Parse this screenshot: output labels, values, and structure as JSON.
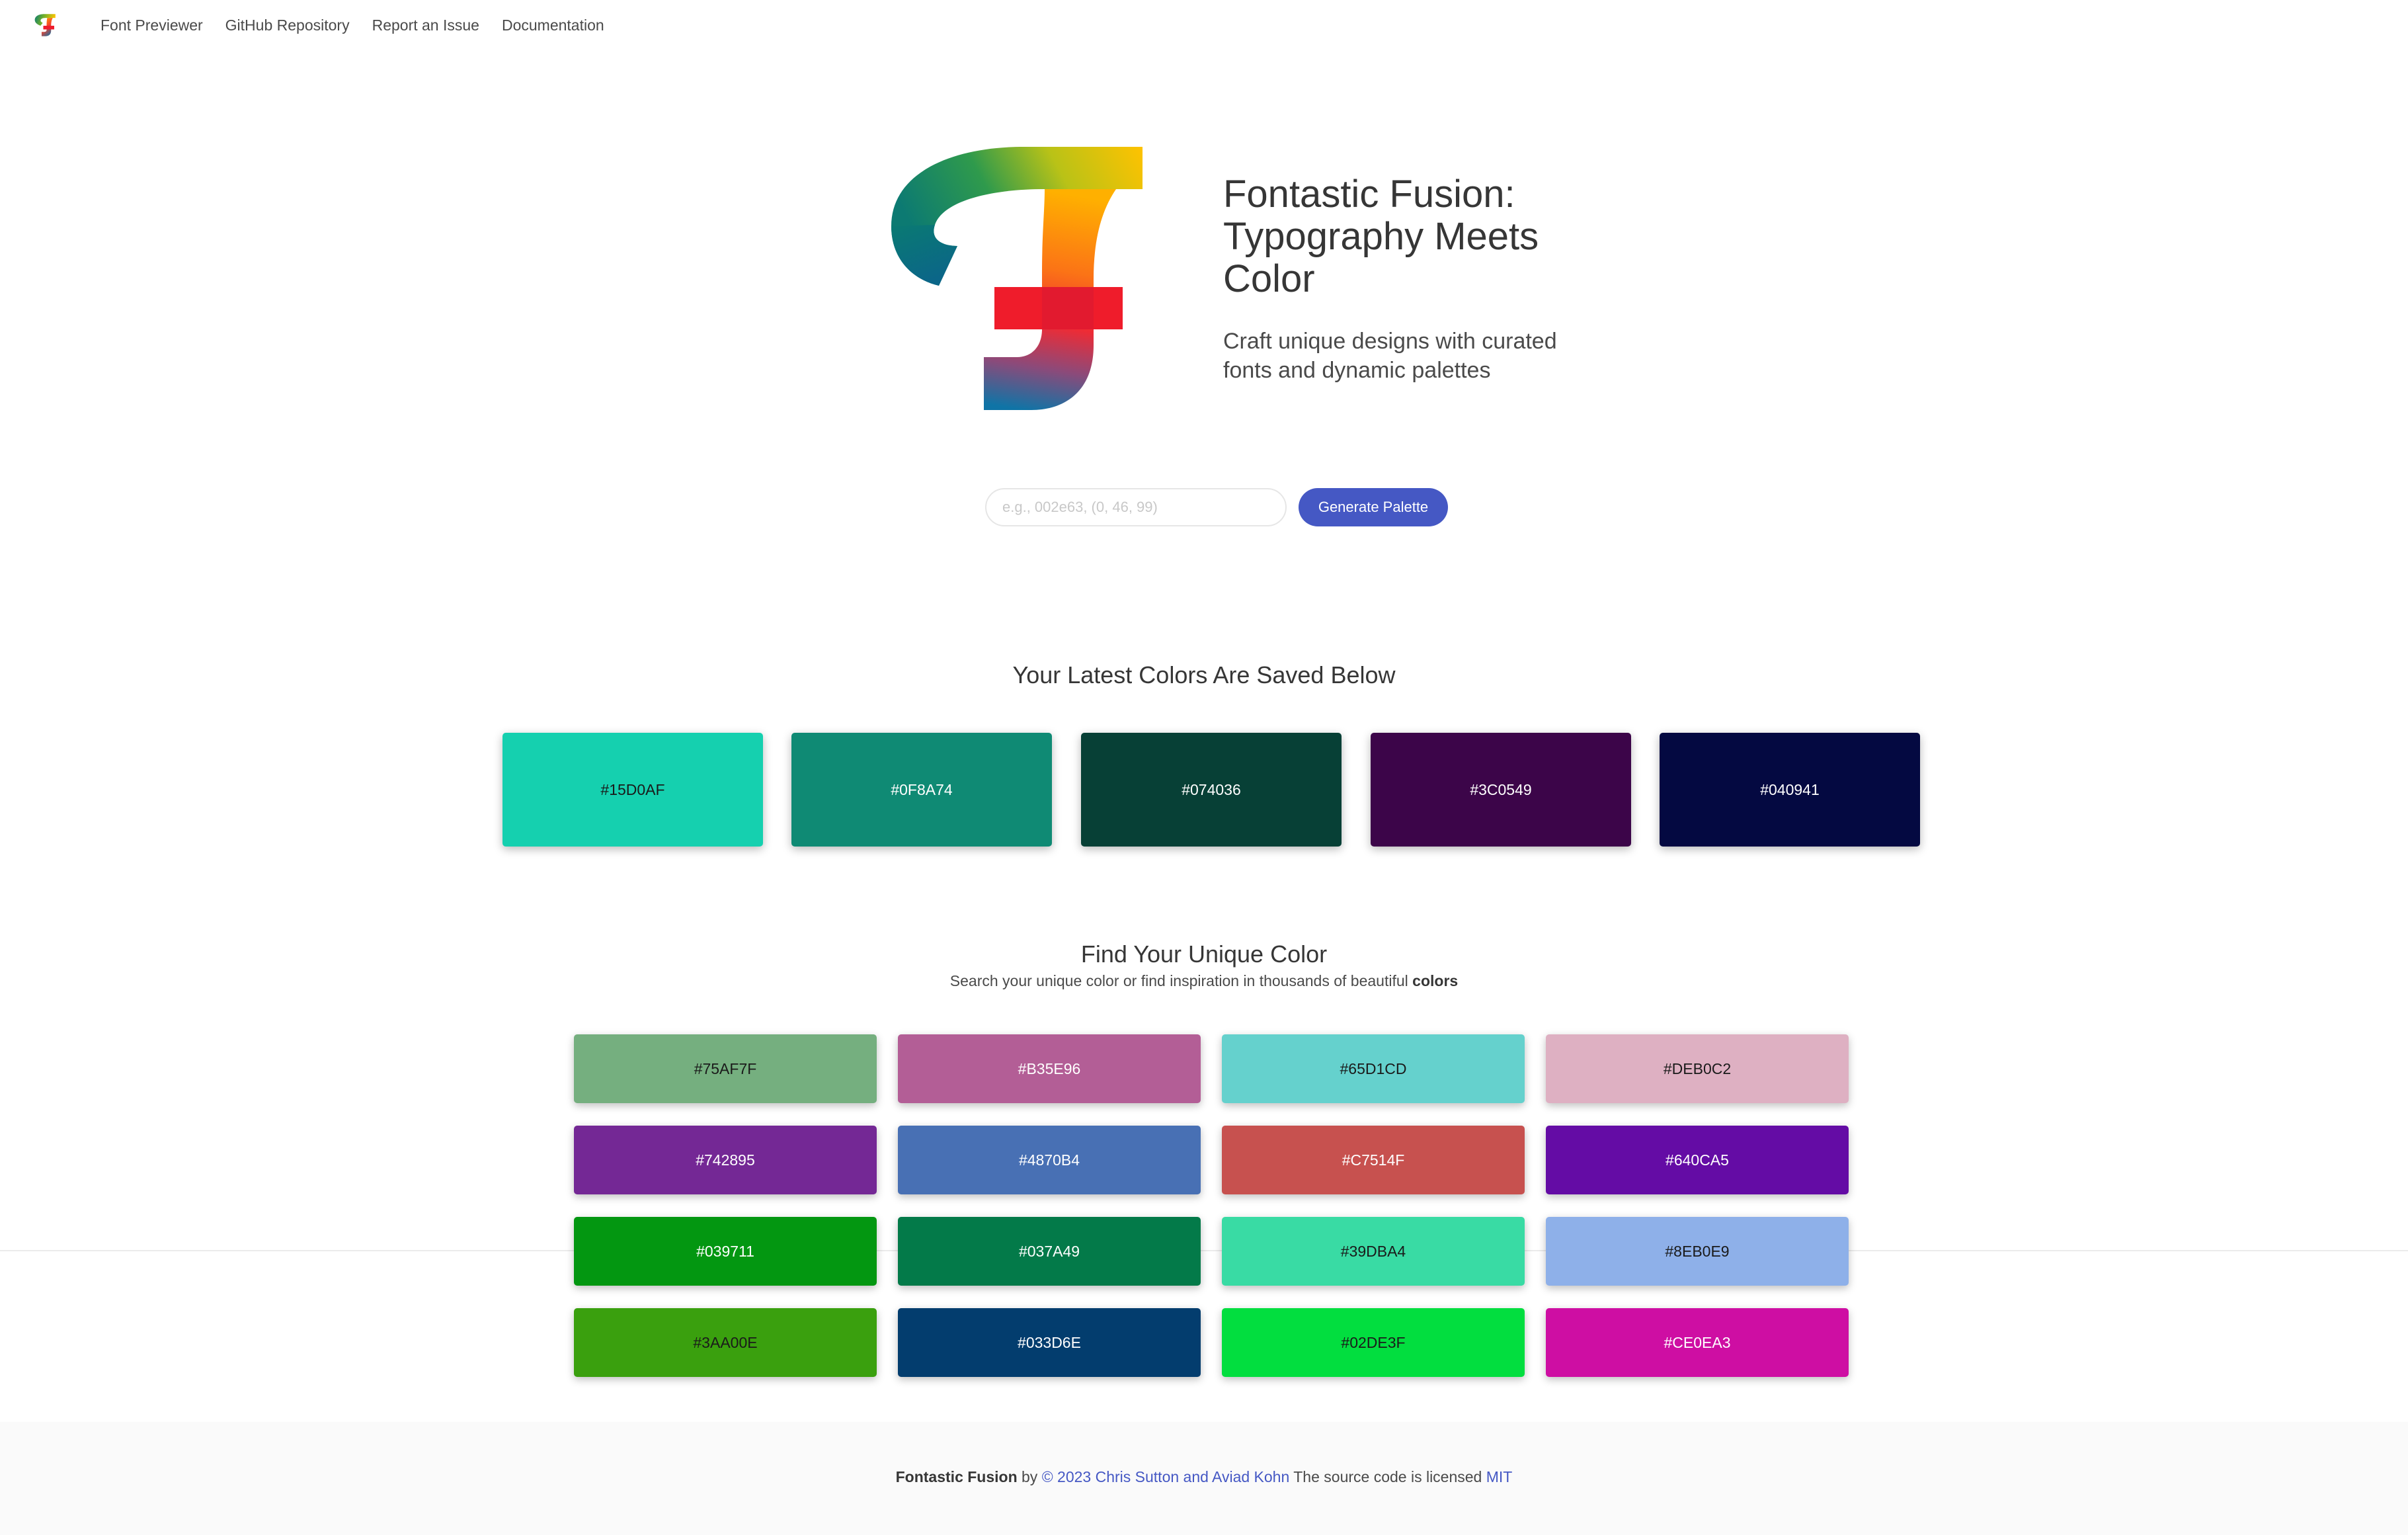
{
  "nav": {
    "logo_icon": "fontastic-fusion-logo-icon",
    "links": [
      "Font Previewer",
      "GitHub Repository",
      "Report an Issue",
      "Documentation"
    ]
  },
  "hero": {
    "title": "Fontastic Fusion: Typography Meets Color",
    "subtitle": "Craft unique designs with curated fonts and dynamic palettes"
  },
  "search": {
    "placeholder": "e.g., 002e63, (0, 46, 99)",
    "value": "",
    "button_label": "Generate Palette"
  },
  "latest": {
    "title": "Your Latest Colors Are Saved Below",
    "colors": [
      {
        "hex": "#15D0AF",
        "text_color": "#1a1a1a"
      },
      {
        "hex": "#0F8A74",
        "text_color": "#ffffff"
      },
      {
        "hex": "#074036",
        "text_color": "#ffffff"
      },
      {
        "hex": "#3C0549",
        "text_color": "#ffffff"
      },
      {
        "hex": "#040941",
        "text_color": "#ffffff"
      }
    ]
  },
  "find": {
    "title": "Find Your Unique Color",
    "subtitle": "Search your unique color or find inspiration in thousands of beautiful",
    "subtitle_bold": "colors",
    "colors": [
      {
        "hex": "#75AF7F",
        "text_color": "#1a1a1a"
      },
      {
        "hex": "#B35E96",
        "text_color": "#ffffff"
      },
      {
        "hex": "#65D1CD",
        "text_color": "#1a1a1a"
      },
      {
        "hex": "#DEB0C2",
        "text_color": "#1a1a1a"
      },
      {
        "hex": "#742895",
        "text_color": "#ffffff"
      },
      {
        "hex": "#4870B4",
        "text_color": "#ffffff"
      },
      {
        "hex": "#C7514F",
        "text_color": "#ffffff"
      },
      {
        "hex": "#640CA5",
        "text_color": "#ffffff"
      },
      {
        "hex": "#039711",
        "text_color": "#ffffff"
      },
      {
        "hex": "#037A49",
        "text_color": "#ffffff"
      },
      {
        "hex": "#39DBA4",
        "text_color": "#1a1a1a"
      },
      {
        "hex": "#8EB0E9",
        "text_color": "#1a1a1a"
      },
      {
        "hex": "#3AA00E",
        "text_color": "#1a1a1a"
      },
      {
        "hex": "#033D6E",
        "text_color": "#ffffff"
      },
      {
        "hex": "#02DE3F",
        "text_color": "#1a1a1a"
      },
      {
        "hex": "#CE0EA3",
        "text_color": "#ffffff"
      }
    ]
  },
  "footer": {
    "brand": "Fontastic Fusion",
    "by": "by",
    "authors_link": "© 2023 Chris Sutton and Aviad Kohn",
    "license_text": "The source code is licensed",
    "license_link": "MIT"
  },
  "colors": {
    "primary": "#4558c4",
    "text": "#363636",
    "footer_bg": "#fafafa"
  }
}
